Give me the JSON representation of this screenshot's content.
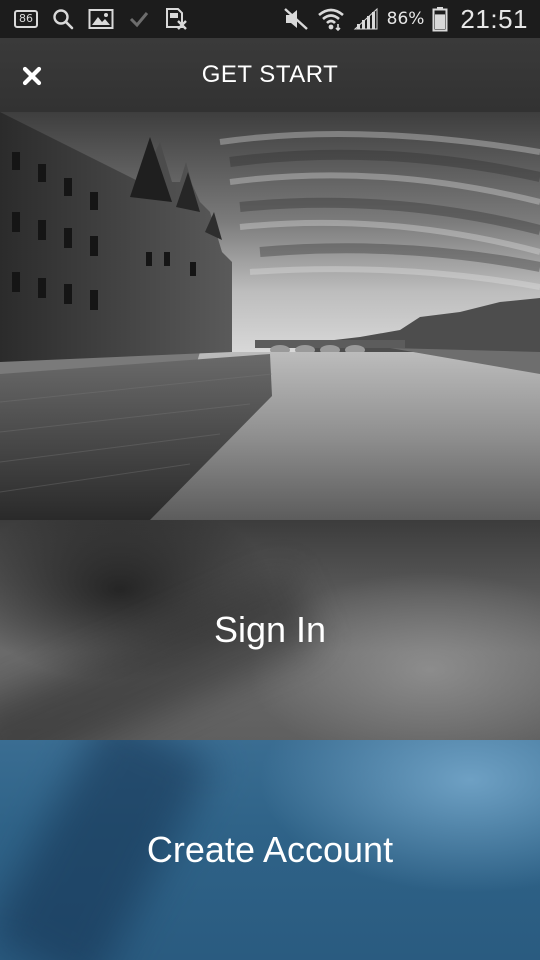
{
  "status_bar": {
    "notification_badge": "86",
    "icons": [
      "notification-count-icon",
      "search-icon",
      "gallery-icon",
      "check-icon",
      "sd-card-icon",
      "mute-icon",
      "wifi-icon",
      "signal-icon",
      "battery-icon"
    ],
    "battery_percent": "86%",
    "battery_level": 0.86,
    "time": "21:51"
  },
  "header": {
    "title": "GET START",
    "close_icon": "close-icon"
  },
  "hero": {
    "image": "black-and-white photo of a riverside castle with a stone embankment and a long bridge under a streaked sky"
  },
  "actions": {
    "sign_in_label": "Sign In",
    "create_account_label": "Create Account"
  },
  "colors": {
    "status_bar_bg": "#1c1c1c",
    "header_bg": "#363636",
    "create_account_bg": "#2f6388",
    "text": "#ffffff"
  }
}
